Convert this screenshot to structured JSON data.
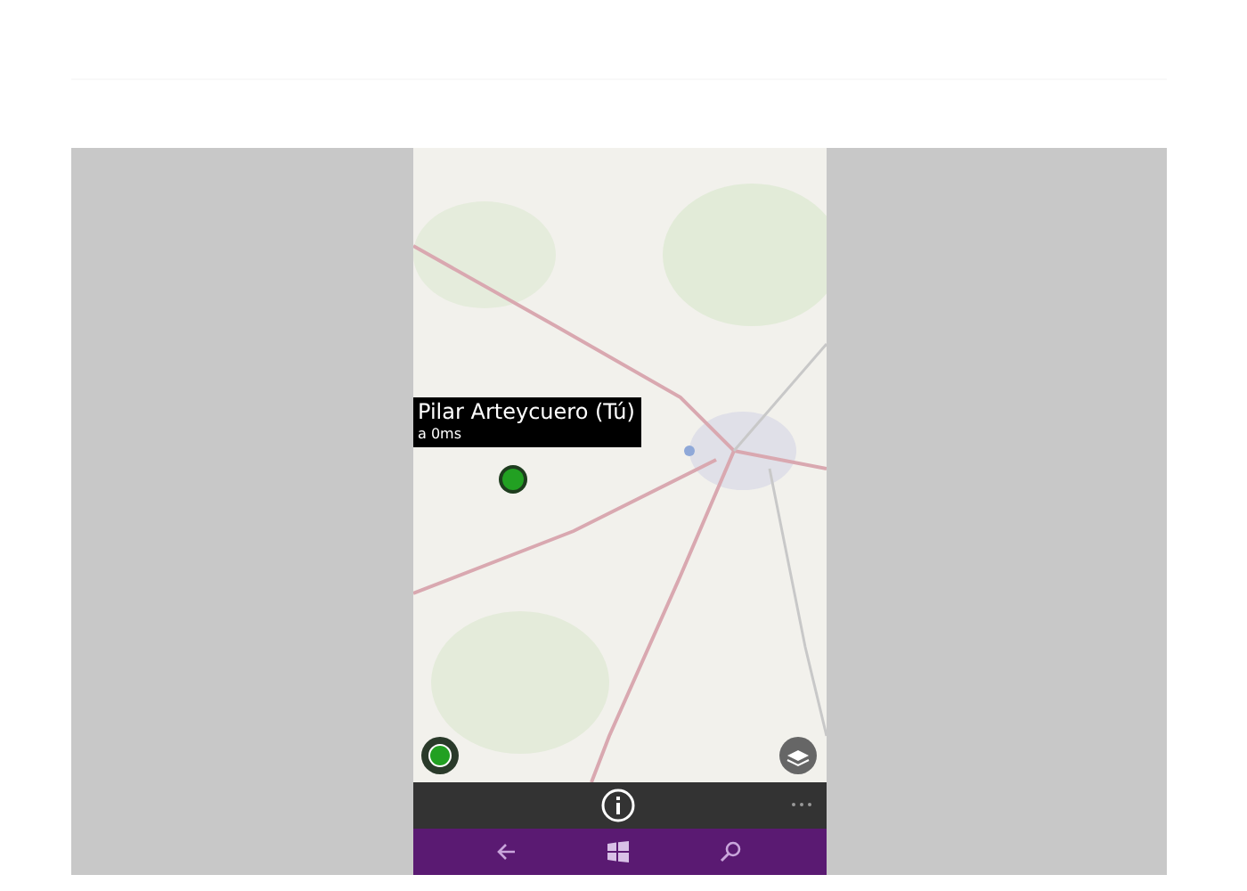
{
  "callout": {
    "title": "Pilar Arteycuero (Tú)",
    "distance": "a 0ms"
  }
}
